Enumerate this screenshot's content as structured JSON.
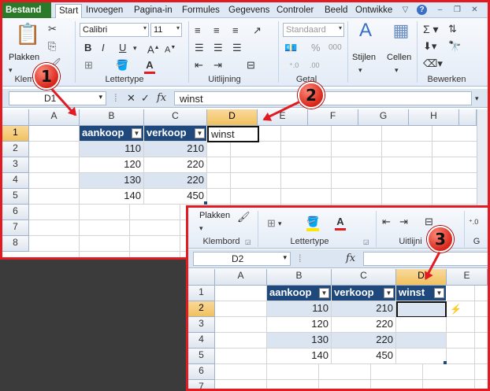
{
  "tabs": [
    "Bestand",
    "Start",
    "Invoegen",
    "Pagina-in",
    "Formules",
    "Gegevens",
    "Controler",
    "Beeld",
    "Ontwikke"
  ],
  "ribbon": {
    "paste_label": "Plakken",
    "clipboard_label": "Klembord",
    "font_name": "Calibri",
    "font_size": "11",
    "font_label": "Lettertype",
    "align_label": "Uitlijning",
    "number_format": "Standaard",
    "number_label": "Getal",
    "styles_label": "Stijlen",
    "cells_label": "Cellen",
    "edit_label": "Bewerken",
    "bold": "B",
    "italic": "I",
    "underline": "U",
    "percent": "%",
    "thousands": "000",
    "font_color_glyph": "A",
    "fx": "fx"
  },
  "screen1": {
    "name_box": "D1",
    "formula": "winst",
    "columns": [
      "A",
      "B",
      "C",
      "D",
      "E",
      "F",
      "G",
      "H"
    ],
    "rows": [
      "1",
      "2",
      "3",
      "4",
      "5",
      "6",
      "7",
      "8"
    ],
    "table": {
      "headers": [
        "aankoop",
        "verkoop"
      ],
      "rows": [
        [
          "110",
          "210"
        ],
        [
          "120",
          "220"
        ],
        [
          "130",
          "220"
        ],
        [
          "140",
          "450"
        ]
      ]
    },
    "d1_value": "winst"
  },
  "screen2": {
    "paste_label": "Plakken",
    "clipboard_label": "Klembord",
    "font_label": "Lettertype",
    "align_label": "Uitlijni",
    "right_cut": "G",
    "name_box": "D2",
    "columns": [
      "A",
      "B",
      "C",
      "D",
      "E"
    ],
    "rows": [
      "1",
      "2",
      "3",
      "4",
      "5",
      "6",
      "7"
    ],
    "table": {
      "headers": [
        "aankoop",
        "verkoop",
        "winst"
      ],
      "rows": [
        [
          "110",
          "210"
        ],
        [
          "120",
          "220"
        ],
        [
          "130",
          "220"
        ],
        [
          "140",
          "450"
        ]
      ]
    }
  },
  "callouts": [
    "1",
    "2",
    "3"
  ],
  "colors": {
    "highlight": "#e21a22",
    "table_header": "#1f497d",
    "band": "#dbe5f1",
    "file_tab": "#2a7a2a"
  }
}
